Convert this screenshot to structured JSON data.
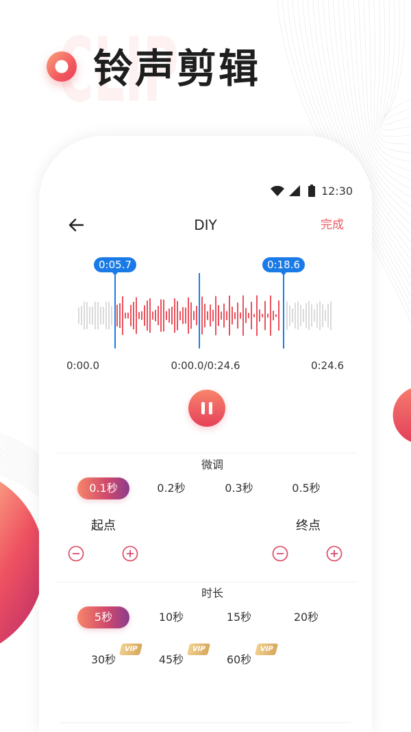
{
  "hero": {
    "title": "铃声剪辑",
    "watermark": "CLIP",
    "logo_icon": "ring-logo-icon"
  },
  "status_bar": {
    "time": "12:30",
    "icons": [
      "wifi-icon",
      "signal-icon",
      "battery-icon"
    ]
  },
  "header": {
    "back_icon": "arrow-left-icon",
    "title": "DIY",
    "done_label": "完成"
  },
  "waveform": {
    "start_marker": "0:05.7",
    "end_marker": "0:18.6"
  },
  "timeline": {
    "start": "0:00.0",
    "progress": "0:00.0/0:24.6",
    "end": "0:24.6"
  },
  "player": {
    "icon": "pause-icon"
  },
  "fine_tune": {
    "title": "微调",
    "options": [
      {
        "label": "0.1秒",
        "selected": true
      },
      {
        "label": "0.2秒",
        "selected": false
      },
      {
        "label": "0.3秒",
        "selected": false
      },
      {
        "label": "0.5秒",
        "selected": false
      }
    ],
    "start_point": {
      "label": "起点",
      "decrease_icon": "minus-circle-icon",
      "increase_icon": "plus-circle-icon"
    },
    "end_point": {
      "label": "终点",
      "decrease_icon": "minus-circle-icon",
      "increase_icon": "plus-circle-icon"
    }
  },
  "duration": {
    "title": "时长",
    "options": [
      {
        "label": "5秒",
        "selected": true
      },
      {
        "label": "10秒",
        "selected": false
      },
      {
        "label": "15秒",
        "selected": false
      },
      {
        "label": "20秒",
        "selected": false
      },
      {
        "label": "30秒",
        "selected": false,
        "badge": "VIP"
      },
      {
        "label": "45秒",
        "selected": false,
        "badge": "VIP"
      },
      {
        "label": "60秒",
        "selected": false,
        "badge": "VIP"
      }
    ]
  },
  "colors": {
    "accent": "#ec5a5f",
    "marker_blue": "#1b7be6",
    "waveform_selected": "#e9505c",
    "waveform_unselected": "#dadada",
    "selected_pill_start": "#f6866a",
    "selected_pill_end": "#8c3c8e",
    "vip_gold": "#d8a85e"
  }
}
